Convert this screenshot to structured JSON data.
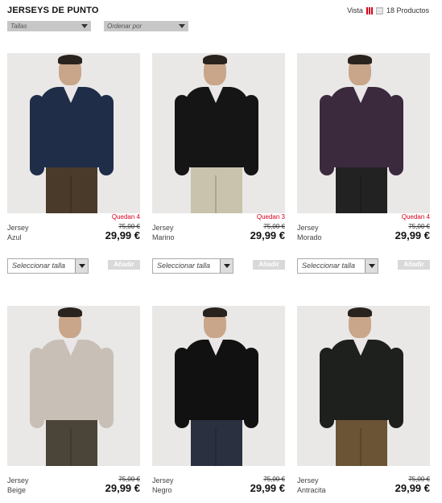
{
  "header": {
    "title": "JERSEYS DE PUNTO",
    "view_label": "Vista",
    "count_label": "18 Productos"
  },
  "filters": {
    "sizes_label": "Tallas",
    "sort_label": "Ordenar por"
  },
  "product_actions": {
    "size_placeholder": "Seleccionar talla",
    "add_label": "Añadir"
  },
  "products": [
    {
      "name": "Jersey",
      "color": "Azul",
      "stock": "Quedan 4",
      "old_price": "75,00 €",
      "price": "29,99 €",
      "sweater_hex": "#1f2d48",
      "pants_hex": "#4a3a2a"
    },
    {
      "name": "Jersey",
      "color": "Marino",
      "stock": "Quedan 3",
      "old_price": "75,00 €",
      "price": "29,99 €",
      "sweater_hex": "#151515",
      "pants_hex": "#c9c2ac"
    },
    {
      "name": "Jersey",
      "color": "Morado",
      "stock": "Quedan 4",
      "old_price": "75,00 €",
      "price": "29,99 €",
      "sweater_hex": "#3b2a3e",
      "pants_hex": "#222222"
    },
    {
      "name": "Jersey",
      "color": "Beige",
      "stock": "",
      "old_price": "75,00 €",
      "price": "29,99 €",
      "sweater_hex": "#c8bfb7",
      "pants_hex": "#4b4438"
    },
    {
      "name": "Jersey",
      "color": "Negro",
      "stock": "",
      "old_price": "75,00 €",
      "price": "29,99 €",
      "sweater_hex": "#111111",
      "pants_hex": "#2a3040"
    },
    {
      "name": "Jersey",
      "color": "Antracita",
      "stock": "",
      "old_price": "75,00 €",
      "price": "29,99 €",
      "sweater_hex": "#1e201e",
      "pants_hex": "#6b5335"
    }
  ],
  "colors": {
    "accent": "#d6001c",
    "dropdown_bg": "#c7c7c7",
    "button_bg": "#d9d9d9"
  }
}
